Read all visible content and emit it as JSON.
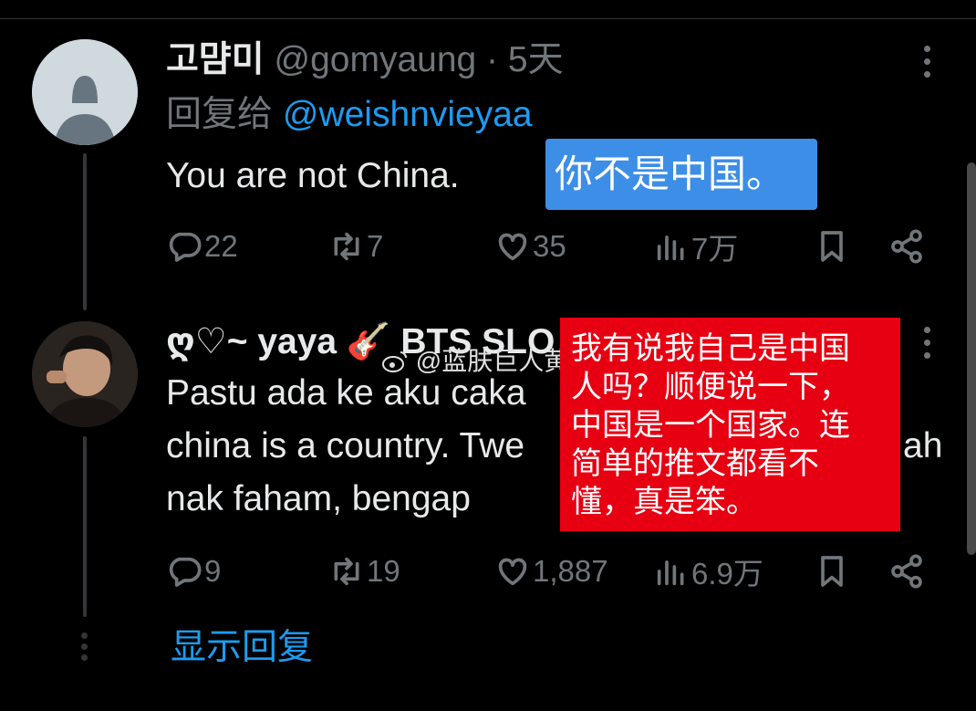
{
  "tweets": [
    {
      "display_name": "고먐미",
      "handle": "@gomyaung",
      "separator": "·",
      "time": "5天",
      "reply_label": "回复给",
      "reply_mention": "@weishnvieyaa",
      "text": "You are not China.",
      "stats": {
        "replies": "22",
        "retweets": "7",
        "likes": "35",
        "views": "7万"
      }
    },
    {
      "display_name": "ღ♡~ yaya 🎸 BTS SLO",
      "text_lines": [
        "Pastu ada ke aku caka",
        "china is a country. Twe",
        "nak faham, bengap"
      ],
      "text_cut": "ah",
      "stats": {
        "replies": "9",
        "retweets": "19",
        "likes": "1,887",
        "views": "6.9万"
      }
    }
  ],
  "translation_blue": "你不是中国。",
  "translation_red_lines": [
    "我有说我自己是中国",
    "人吗？顺便说一下，",
    "中国是一个国家。连",
    "简单的推文都看不",
    "懂，真是笨。"
  ],
  "watermark": "@蓝肤巨人黄",
  "show_replies": "显示回复",
  "icons": [
    "default-avatar-icon",
    "reply-icon",
    "retweet-icon",
    "like-icon",
    "views-icon",
    "bookmark-icon",
    "share-icon",
    "more-icon",
    "weibo-icon"
  ],
  "colors": {
    "background": "#000000",
    "link": "#1d9bf0",
    "muted": "#71767b",
    "overlay_blue": "#3d8ee6",
    "overlay_red": "#e60012"
  }
}
